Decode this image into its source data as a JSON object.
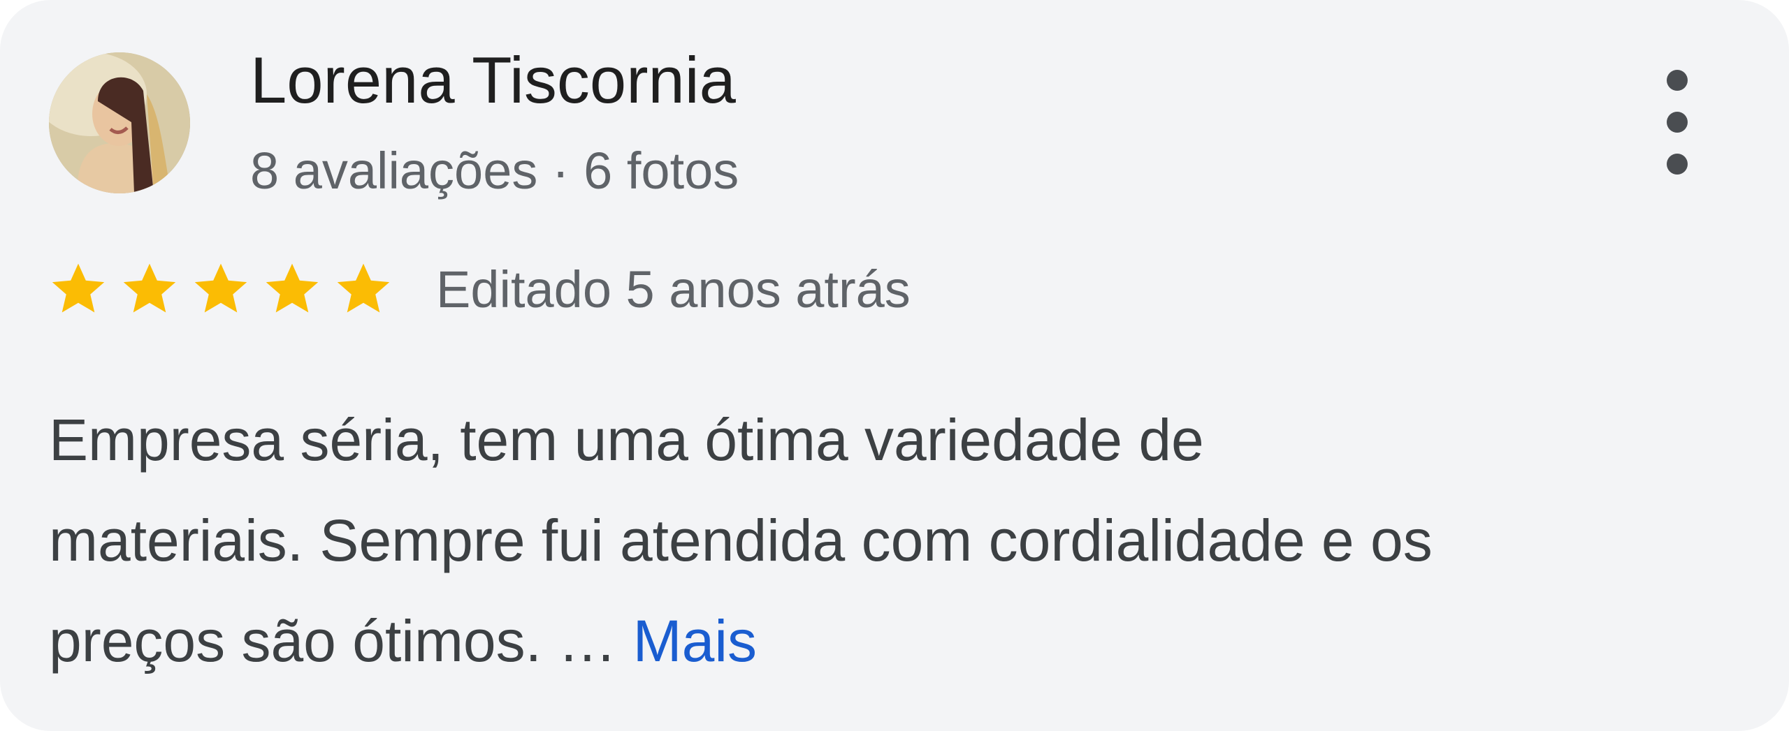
{
  "review": {
    "reviewer_name": "Lorena Tiscornia",
    "reviewer_meta": "8 avaliações · 6 fotos",
    "rating": 5,
    "rating_max": 5,
    "edited_time": "Editado 5 anos atrás",
    "text_lines": [
      "Empresa séria, tem uma ótima variedade de",
      "materiais. Sempre fui atendida com cordialidade e os",
      "preços são ótimos. … "
    ],
    "more_label": "Mais"
  },
  "icons": {
    "avatar": "avatar-photo",
    "menu": "more-vert-icon",
    "star": "star-icon"
  },
  "colors": {
    "card_background": "#f3f4f6",
    "name_text": "#1f1f1f",
    "secondary_text": "#5f6368",
    "body_text": "#3c4043",
    "star": "#fbbc04",
    "link": "#1a5dd0"
  }
}
